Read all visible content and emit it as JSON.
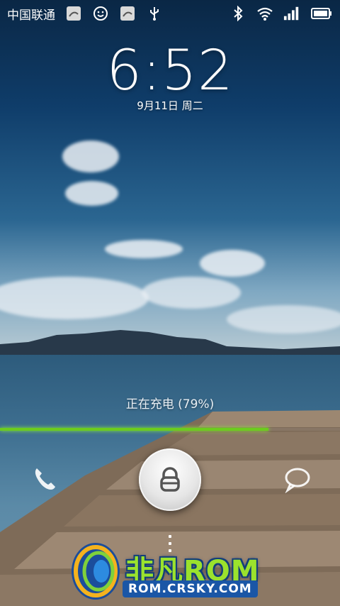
{
  "status_bar": {
    "carrier": "中国联通",
    "icons_left": [
      "notification-app-icon",
      "smiley-icon",
      "notification-app-icon",
      "usb-icon"
    ],
    "icons_right": [
      "bluetooth-icon",
      "wifi-icon",
      "signal-icon",
      "battery-icon"
    ]
  },
  "clock": {
    "time": "6:52",
    "date": "9月11日 周二"
  },
  "charging": {
    "text": "正在充电 (79%)",
    "level": 0.79,
    "bar_color": "#6ccc1e"
  },
  "unlock": {
    "center_icon": "lock-icon",
    "left_icon": "phone-icon",
    "right_icon": "message-icon"
  },
  "watermark": {
    "title": "非凡ROM",
    "url": "ROM.CRSKY.COM"
  }
}
